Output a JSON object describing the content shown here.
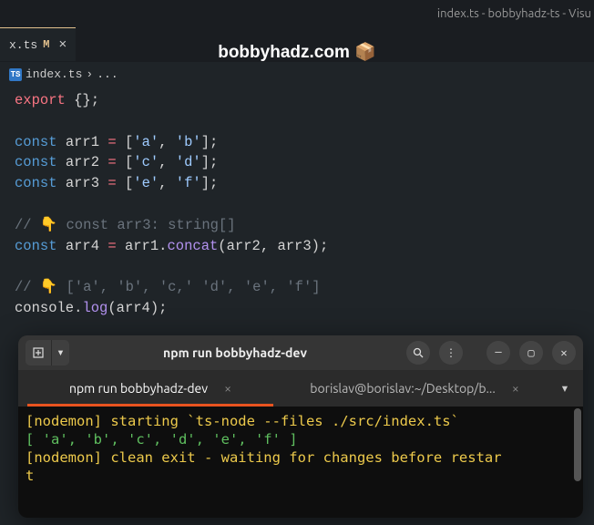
{
  "window_title": "index.ts - bobbyhadz-ts - Visu",
  "brand": "bobbyhadz.com 📦",
  "tab": {
    "filename": "x.ts",
    "modified": "M"
  },
  "breadcrumb": {
    "file": "index.ts",
    "sep": "›",
    "more": "..."
  },
  "code": {
    "l1_export": "export",
    "l1_rest": " {};",
    "const": "const",
    "arr1": "arr1",
    "arr2": "arr2",
    "arr3": "arr3",
    "arr4": "arr4",
    "eq": " = ",
    "v1a": "'a'",
    "v1b": "'b'",
    "v2c": "'c'",
    "v2d": "'d'",
    "v3e": "'e'",
    "v3f": "'f'",
    "open": "[",
    "close": "];",
    "comma": ", ",
    "comment1": "// 👇️ const arr3: string[]",
    "concat": "concat",
    "dot": ".",
    "lparen": "(",
    "rparen": ");",
    "rparen2": ");",
    "comment2": "// 👇️ ['a', 'b', 'c,' 'd', 'e', 'f']",
    "console": "console",
    "log": "log"
  },
  "terminal": {
    "title": "npm run bobbyhadz-dev",
    "tab1": "npm run bobbyhadz-dev",
    "tab2": "borislav@borislav:~/Desktop/b...",
    "line1": "[nodemon] starting `ts-node --files ./src/index.ts`",
    "line2": "[ 'a', 'b', 'c', 'd', 'e', 'f' ]",
    "line3": "[nodemon] clean exit - waiting for changes before restar",
    "line4": "t"
  }
}
